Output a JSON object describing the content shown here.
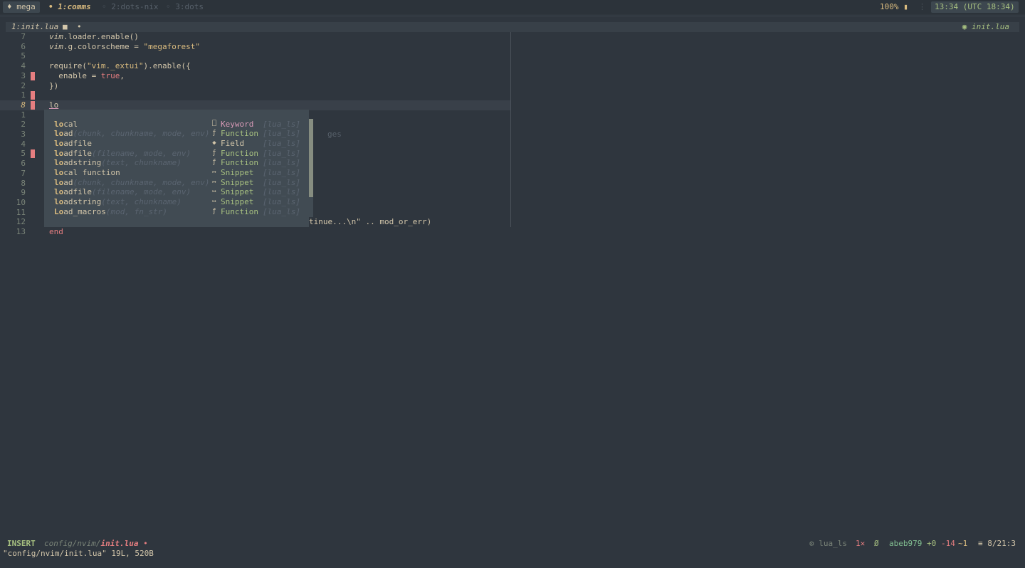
{
  "tmux": {
    "session": "♦ mega",
    "windows": [
      {
        "label": "• 1:comms",
        "active": true
      },
      {
        "label": "◦ 2:dots-nix",
        "active": false
      },
      {
        "label": "◦ 3:dots",
        "active": false
      }
    ],
    "battery": "100% ▮",
    "separator": "⋮",
    "clock": "13:34 (UTC 18:34)"
  },
  "winbar": {
    "title": "1:init.lua",
    "modified": "■",
    "dot": "•",
    "right": "◉ init.lua"
  },
  "editor": {
    "lines": [
      {
        "nr": "7",
        "sign": false,
        "current": false
      },
      {
        "nr": "6",
        "sign": false,
        "current": false
      },
      {
        "nr": "5",
        "sign": false,
        "current": false
      },
      {
        "nr": "4",
        "sign": false,
        "current": false
      },
      {
        "nr": "3",
        "sign": true,
        "current": false
      },
      {
        "nr": "2",
        "sign": false,
        "current": false
      },
      {
        "nr": "1",
        "sign": true,
        "current": false
      },
      {
        "nr": "8",
        "sign": true,
        "current": true
      },
      {
        "nr": "1",
        "sign": false,
        "current": false
      },
      {
        "nr": "2",
        "sign": false,
        "current": false
      },
      {
        "nr": "3",
        "sign": false,
        "current": false
      },
      {
        "nr": "4",
        "sign": false,
        "current": false
      },
      {
        "nr": "5",
        "sign": true,
        "current": false
      },
      {
        "nr": "6",
        "sign": false,
        "current": false
      },
      {
        "nr": "7",
        "sign": false,
        "current": false
      },
      {
        "nr": "8",
        "sign": false,
        "current": false
      },
      {
        "nr": "9",
        "sign": false,
        "current": false
      },
      {
        "nr": "10",
        "sign": false,
        "current": false
      },
      {
        "nr": "11",
        "sign": false,
        "current": false
      },
      {
        "nr": "12",
        "sign": false,
        "current": false
      },
      {
        "nr": "13",
        "sign": false,
        "current": false
      }
    ],
    "code": {
      "l1_obj": "vim",
      "l1_rest": ".loader.enable()",
      "l2_obj": "vim",
      "l2_mid": ".g.colorscheme = ",
      "l2_str": "\"megaforest\"",
      "l4_fn": "require",
      "l4_open": "(",
      "l4_str": "\"vim._extui\"",
      "l4_rest": ").enable({",
      "l5_key": "  enable = ",
      "l5_val": "true",
      "l5_comma": ",",
      "l6": "})",
      "l8_typed": "lo",
      "l21": "end"
    },
    "ghost_text": "ges",
    "trailing_code": "tinue...\\n\" .. mod_or_err)"
  },
  "completion": {
    "items": [
      {
        "match": "lo",
        "rest": "cal",
        "detail": "",
        "icon": "⎕",
        "kind": "Keyword",
        "kind_class": "keyword",
        "source": "[lua_ls]"
      },
      {
        "match": "lo",
        "rest": "ad",
        "detail": "(chunk, chunkname, mode, env)",
        "icon": "ƒ",
        "kind": "Function",
        "kind_class": "function",
        "source": "[lua_ls]"
      },
      {
        "match": "lo",
        "rest": "adfile",
        "detail": "",
        "icon": "◆",
        "kind": "Field",
        "kind_class": "field",
        "source": "[lua_ls]"
      },
      {
        "match": "lo",
        "rest": "adfile",
        "detail": "(filename, mode, env)",
        "icon": "ƒ",
        "kind": "Function",
        "kind_class": "function",
        "source": "[lua_ls]"
      },
      {
        "match": "lo",
        "rest": "adstring",
        "detail": "(text, chunkname)",
        "icon": "ƒ",
        "kind": "Function",
        "kind_class": "function",
        "source": "[lua_ls]"
      },
      {
        "match": "lo",
        "rest": "cal function",
        "detail": "",
        "icon": "↦",
        "kind": "Snippet",
        "kind_class": "snippet",
        "source": "[lua_ls]"
      },
      {
        "match": "lo",
        "rest": "ad",
        "detail": "(chunk, chunkname, mode, env)",
        "icon": "↦",
        "kind": "Snippet",
        "kind_class": "snippet",
        "source": "[lua_ls]"
      },
      {
        "match": "lo",
        "rest": "adfile",
        "detail": "(filename, mode, env)",
        "icon": "↦",
        "kind": "Snippet",
        "kind_class": "snippet",
        "source": "[lua_ls]"
      },
      {
        "match": "lo",
        "rest": "adstring",
        "detail": "(text, chunkname)",
        "icon": "↦",
        "kind": "Snippet",
        "kind_class": "snippet",
        "source": "[lua_ls]"
      },
      {
        "match": "Lo",
        "rest": "ad_macros",
        "detail": "(mod, fn_str)",
        "icon": "ƒ",
        "kind": "Function",
        "kind_class": "function",
        "source": "[lua_ls]"
      }
    ]
  },
  "statusline": {
    "mode": "INSERT",
    "path_dir": "config/nvim/",
    "path_file": "init.lua",
    "path_mod": " •",
    "lsp": "⚙ lua_ls",
    "diagnostics": "1✕",
    "null": "Ø",
    "git": "abeb979",
    "added": "+0",
    "removed": "-14",
    "changed": "~1",
    "position": "≡ 8/21:3"
  },
  "cmdline": "\"config/nvim/init.lua\" 19L, 520B",
  "colors": {
    "background": "#2f363e",
    "popup": "#414b53",
    "sign": "#e67e80",
    "green": "#a7c080",
    "yellow": "#dbbc7f",
    "red": "#e67e80",
    "purple": "#d699b6"
  }
}
